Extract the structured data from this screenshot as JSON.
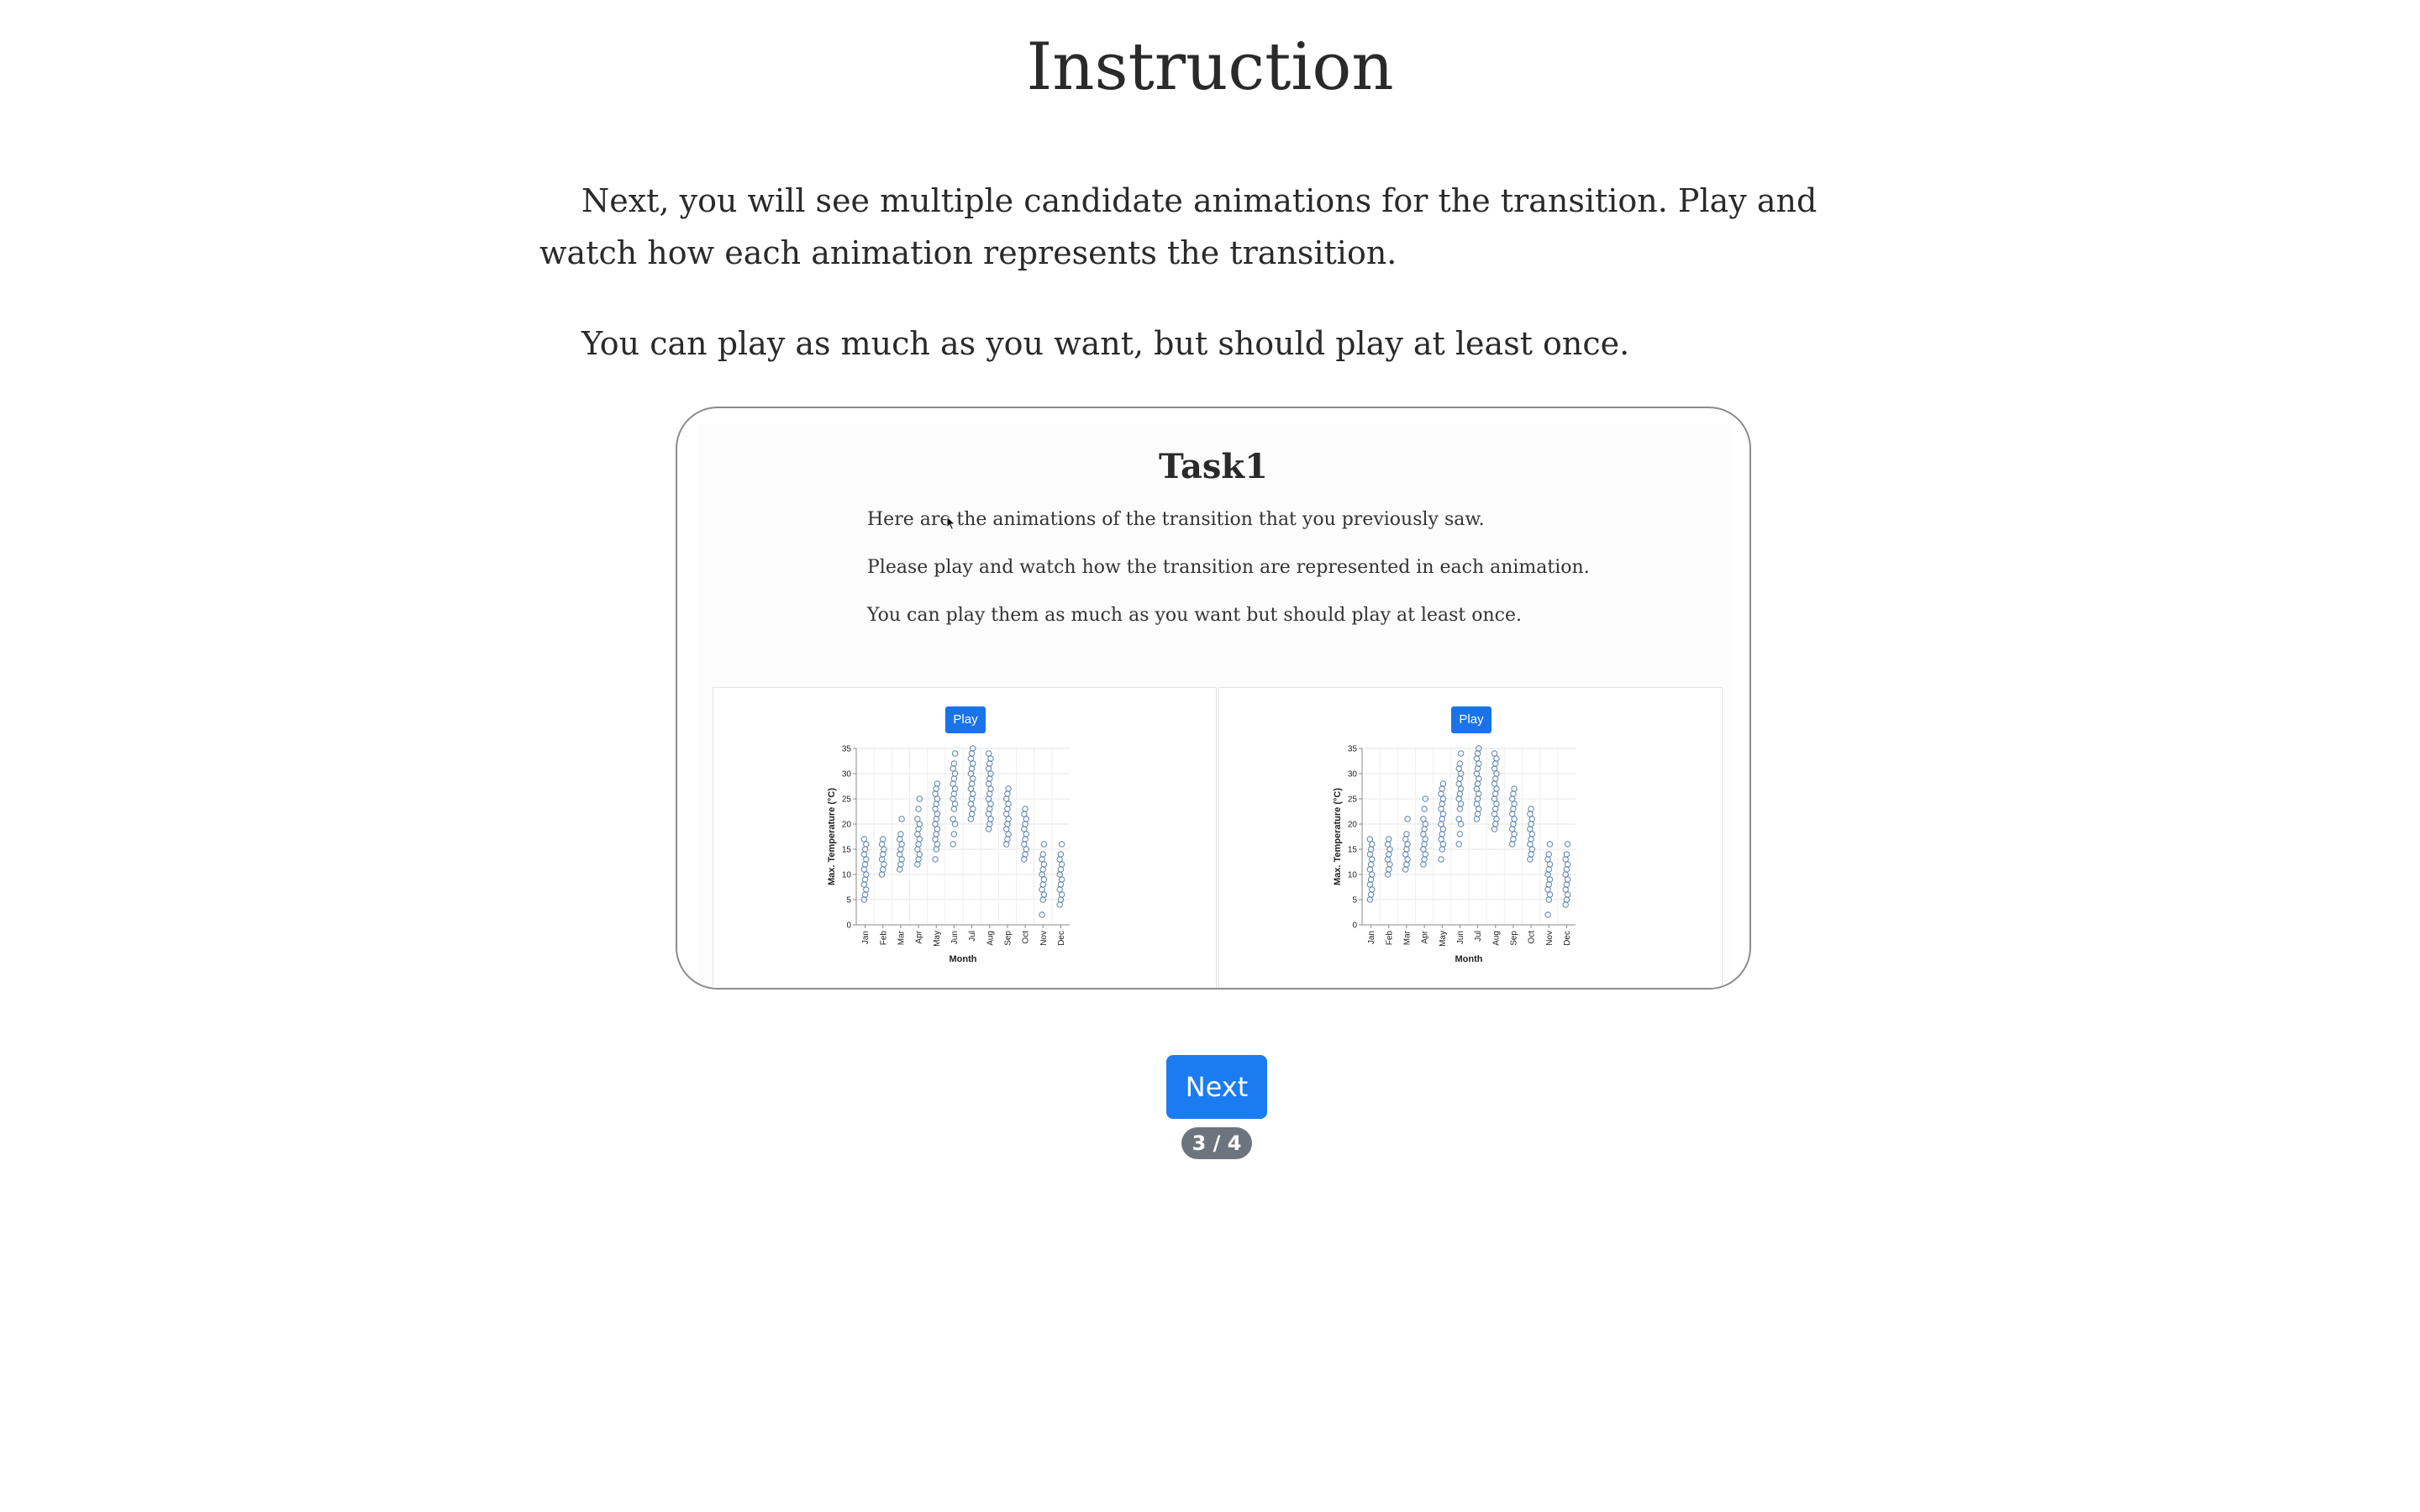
{
  "header": {
    "title": "Instruction"
  },
  "instructions": {
    "paragraph_1": "Next, you will see multiple candidate animations for the transition. Play and watch how each animation represents the transition.",
    "paragraph_2": "You can play as much as you want, but should play at least once."
  },
  "task": {
    "title": "Task1",
    "lines": [
      "Here are the animations of the transition that you previously saw.",
      "Please play and watch how the transition are represented in each animation.",
      "You can play them as much as you want but should play at least once."
    ],
    "panels": [
      {
        "play_label": "Play"
      },
      {
        "play_label": "Play"
      }
    ]
  },
  "footer": {
    "next_label": "Next",
    "progress": "3 / 4",
    "current_page": 3,
    "total_pages": 4
  },
  "colors": {
    "accent": "#1a7cf0",
    "badge": "#6c757d",
    "point_stroke": "#4c78a8"
  },
  "chart_data": [
    {
      "type": "scatter",
      "title": "",
      "xlabel": "Month",
      "ylabel": "Max. Temperature (°C)",
      "categories": [
        "Jan",
        "Feb",
        "Mar",
        "Apr",
        "May",
        "Jun",
        "Jul",
        "Aug",
        "Sep",
        "Oct",
        "Nov",
        "Dec"
      ],
      "ylim": [
        0,
        35
      ],
      "yticks": [
        0,
        5,
        10,
        15,
        20,
        25,
        30,
        35
      ],
      "grid": true,
      "series": [
        {
          "values": [
            [
              5,
              6,
              7,
              8,
              9,
              10,
              11,
              12,
              13,
              14,
              15,
              16,
              17
            ],
            [
              10,
              11,
              12,
              13,
              14,
              15,
              16,
              17
            ],
            [
              11,
              12,
              13,
              14,
              15,
              16,
              17,
              18,
              21
            ],
            [
              12,
              13,
              14,
              15,
              16,
              17,
              18,
              19,
              20,
              21,
              23,
              25
            ],
            [
              13,
              15,
              16,
              17,
              18,
              19,
              20,
              21,
              22,
              23,
              24,
              25,
              26,
              27,
              28
            ],
            [
              16,
              18,
              20,
              21,
              23,
              24,
              25,
              26,
              27,
              28,
              29,
              30,
              31,
              32,
              34
            ],
            [
              21,
              22,
              23,
              24,
              25,
              26,
              27,
              28,
              29,
              30,
              31,
              32,
              33,
              34,
              35
            ],
            [
              19,
              20,
              21,
              22,
              23,
              24,
              25,
              26,
              27,
              28,
              29,
              30,
              31,
              32,
              33,
              34
            ],
            [
              16,
              17,
              18,
              19,
              20,
              21,
              22,
              23,
              24,
              25,
              26,
              27
            ],
            [
              13,
              14,
              15,
              16,
              17,
              18,
              19,
              20,
              21,
              22,
              23
            ],
            [
              2,
              5,
              6,
              7,
              8,
              9,
              10,
              11,
              12,
              13,
              14,
              16
            ],
            [
              4,
              5,
              6,
              7,
              8,
              9,
              10,
              11,
              12,
              13,
              14,
              16
            ]
          ]
        }
      ]
    },
    {
      "type": "scatter",
      "title": "",
      "xlabel": "Month",
      "ylabel": "Max. Temperature (°C)",
      "categories": [
        "Jan",
        "Feb",
        "Mar",
        "Apr",
        "May",
        "Jun",
        "Jul",
        "Aug",
        "Sep",
        "Oct",
        "Nov",
        "Dec"
      ],
      "ylim": [
        0,
        35
      ],
      "yticks": [
        0,
        5,
        10,
        15,
        20,
        25,
        30,
        35
      ],
      "grid": true,
      "series": [
        {
          "values": [
            [
              5,
              6,
              7,
              8,
              9,
              10,
              11,
              12,
              13,
              14,
              15,
              16,
              17
            ],
            [
              10,
              11,
              12,
              13,
              14,
              15,
              16,
              17
            ],
            [
              11,
              12,
              13,
              14,
              15,
              16,
              17,
              18,
              21
            ],
            [
              12,
              13,
              14,
              15,
              16,
              17,
              18,
              19,
              20,
              21,
              23,
              25
            ],
            [
              13,
              15,
              16,
              17,
              18,
              19,
              20,
              21,
              22,
              23,
              24,
              25,
              26,
              27,
              28
            ],
            [
              16,
              18,
              20,
              21,
              23,
              24,
              25,
              26,
              27,
              28,
              29,
              30,
              31,
              32,
              34
            ],
            [
              21,
              22,
              23,
              24,
              25,
              26,
              27,
              28,
              29,
              30,
              31,
              32,
              33,
              34,
              35
            ],
            [
              19,
              20,
              21,
              22,
              23,
              24,
              25,
              26,
              27,
              28,
              29,
              30,
              31,
              32,
              33,
              34
            ],
            [
              16,
              17,
              18,
              19,
              20,
              21,
              22,
              23,
              24,
              25,
              26,
              27
            ],
            [
              13,
              14,
              15,
              16,
              17,
              18,
              19,
              20,
              21,
              22,
              23
            ],
            [
              2,
              5,
              6,
              7,
              8,
              9,
              10,
              11,
              12,
              13,
              14,
              16
            ],
            [
              4,
              5,
              6,
              7,
              8,
              9,
              10,
              11,
              12,
              13,
              14,
              16
            ]
          ]
        }
      ]
    }
  ]
}
